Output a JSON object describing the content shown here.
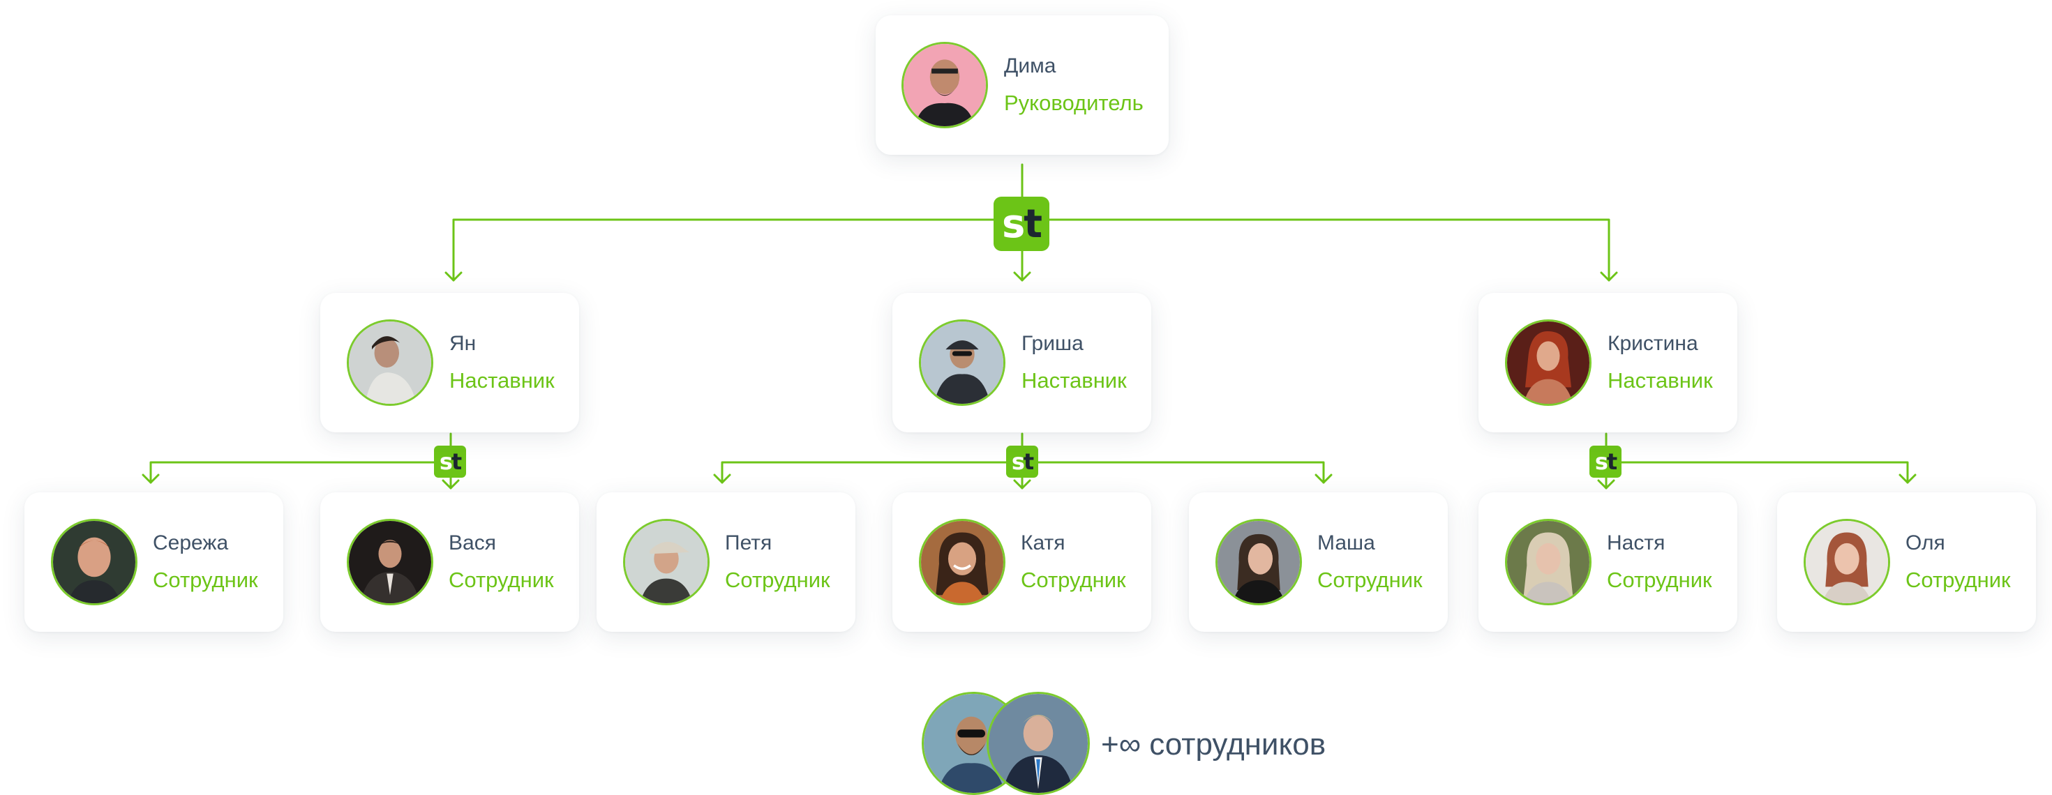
{
  "colors": {
    "accent": "#6cc417",
    "text": "#3f5166",
    "ring": "#7ccb2d"
  },
  "badge": {
    "s": "s",
    "t": "t",
    "icon": "st-logo-icon"
  },
  "head": {
    "name": "Дима",
    "role": "Руководитель"
  },
  "mentors": [
    {
      "name": "Ян",
      "role": "Наставник"
    },
    {
      "name": "Гриша",
      "role": "Наставник"
    },
    {
      "name": "Кристина",
      "role": "Наставник"
    }
  ],
  "employees": [
    {
      "name": "Сережа",
      "role": "Сотрудник"
    },
    {
      "name": "Вася",
      "role": "Сотрудник"
    },
    {
      "name": "Петя",
      "role": "Сотрудник"
    },
    {
      "name": "Катя",
      "role": "Сотрудник"
    },
    {
      "name": "Маша",
      "role": "Сотрудник"
    },
    {
      "name": "Настя",
      "role": "Сотрудник"
    },
    {
      "name": "Оля",
      "role": "Сотрудник"
    }
  ],
  "more": {
    "label": "+∞ сотрудников"
  }
}
